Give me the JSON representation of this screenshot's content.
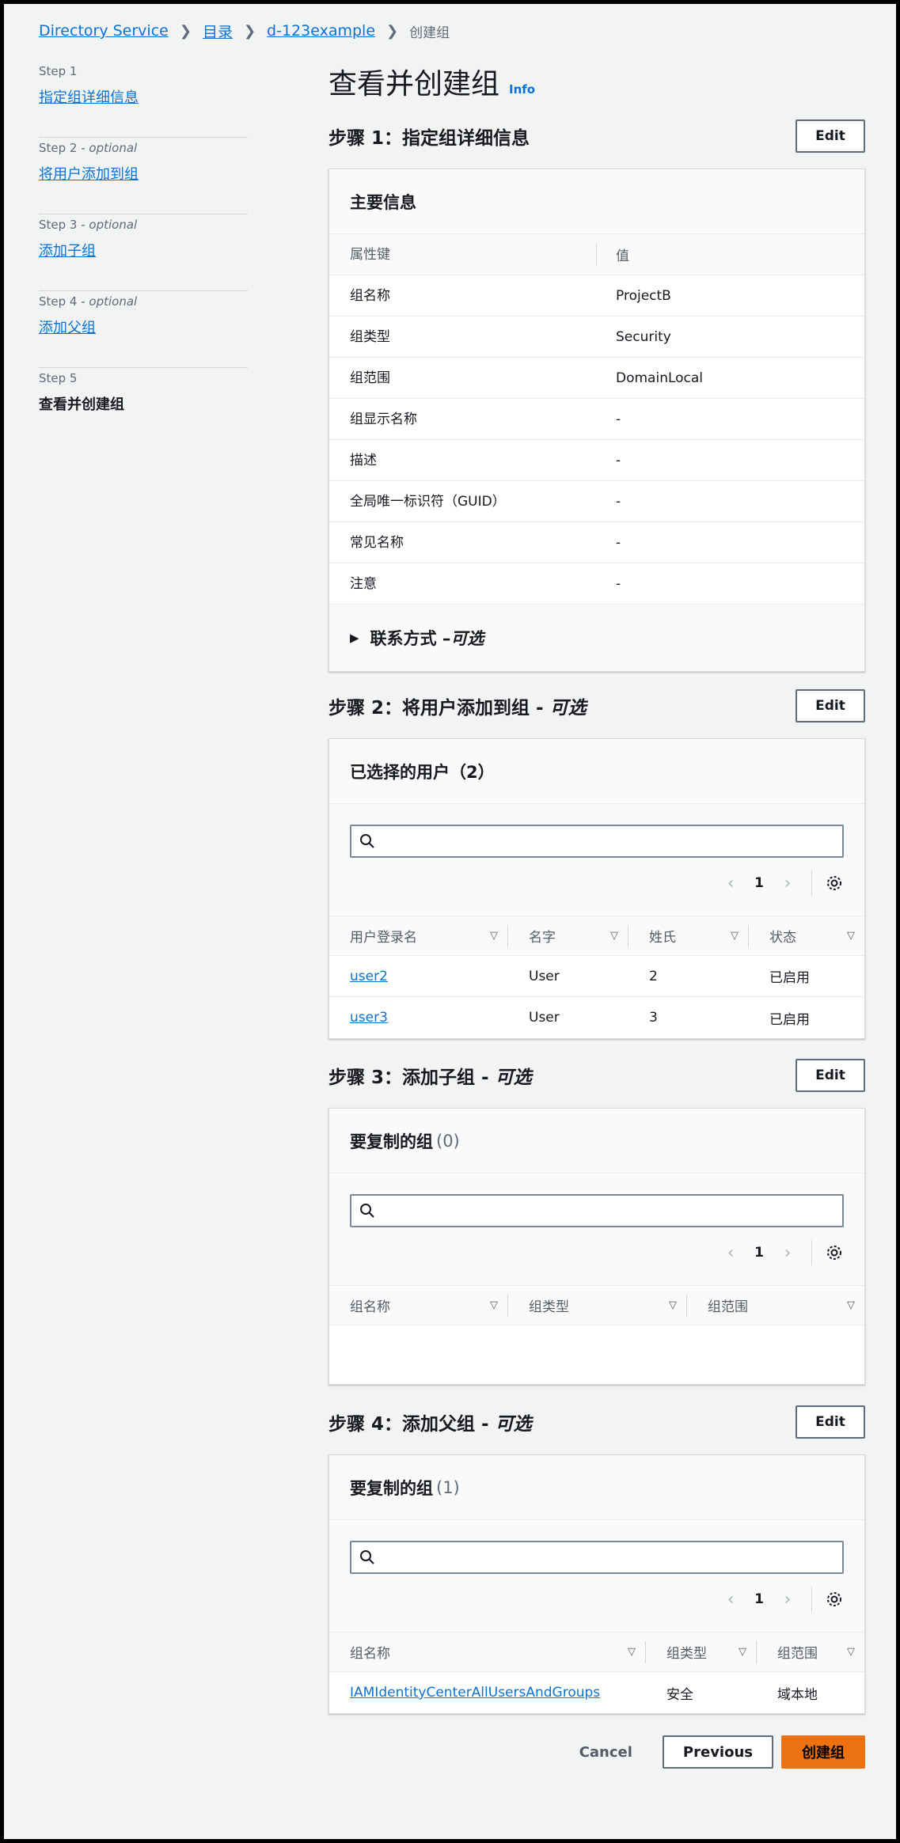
{
  "breadcrumb": {
    "items": [
      "Directory Service",
      "目录",
      "d-123example"
    ],
    "current": "创建组"
  },
  "steps": [
    {
      "label": "Step 1",
      "optional": "",
      "name": "指定组详细信息"
    },
    {
      "label": "Step 2",
      "optional": " - optional",
      "name": "将用户添加到组"
    },
    {
      "label": "Step 3",
      "optional": " - optional",
      "name": "添加子组"
    },
    {
      "label": "Step 4",
      "optional": " - optional",
      "name": "添加父组"
    },
    {
      "label": "Step 5",
      "optional": "",
      "name": "查看并创建组"
    }
  ],
  "page": {
    "title": "查看并创建组",
    "info": "Info"
  },
  "edit_label": "Edit",
  "section1": {
    "title": "步骤 1：指定组详细信息",
    "card_title": "主要信息",
    "col_key": "属性键",
    "col_value": "值",
    "rows": [
      {
        "k": "组名称",
        "v": "ProjectB"
      },
      {
        "k": "组类型",
        "v": "Security"
      },
      {
        "k": "组范围",
        "v": "DomainLocal"
      },
      {
        "k": "组显示名称",
        "v": "-"
      },
      {
        "k": "描述",
        "v": "-"
      },
      {
        "k": "全局唯一标识符（GUID）",
        "v": "-"
      },
      {
        "k": "常见名称",
        "v": "-"
      },
      {
        "k": "注意",
        "v": "-"
      }
    ],
    "expander": "联系方式 – ",
    "expander_optional": "可选"
  },
  "section2": {
    "title": "步骤 2：将用户添加到组 - ",
    "title_optional": "可选",
    "card_title": "已选择的用户（2）",
    "page": "1",
    "columns": [
      "用户登录名",
      "名字",
      "姓氏",
      "状态"
    ],
    "rows": [
      {
        "login": "user2",
        "first": "User",
        "last": "2",
        "status": "已启用"
      },
      {
        "login": "user3",
        "first": "User",
        "last": "3",
        "status": "已启用"
      }
    ]
  },
  "section3": {
    "title": "步骤 3：添加子组 - ",
    "title_optional": "可选",
    "card_title": "要复制的组",
    "count": "(0)",
    "page": "1",
    "columns": [
      "组名称",
      "组类型",
      "组范围"
    ]
  },
  "section4": {
    "title": "步骤 4：添加父组 - ",
    "title_optional": "可选",
    "card_title": "要复制的组",
    "count": "(1)",
    "page": "1",
    "columns": [
      "组名称",
      "组类型",
      "组范围"
    ],
    "rows": [
      {
        "name": "IAMIdentityCenterAllUsersAndGroups",
        "type": "安全",
        "scope": "域本地"
      }
    ]
  },
  "footer": {
    "cancel": "Cancel",
    "previous": "Previous",
    "create": "创建组"
  },
  "colors": {
    "link": "#0972d3",
    "primary": "#ec7211",
    "background": "#f2f3f3"
  }
}
